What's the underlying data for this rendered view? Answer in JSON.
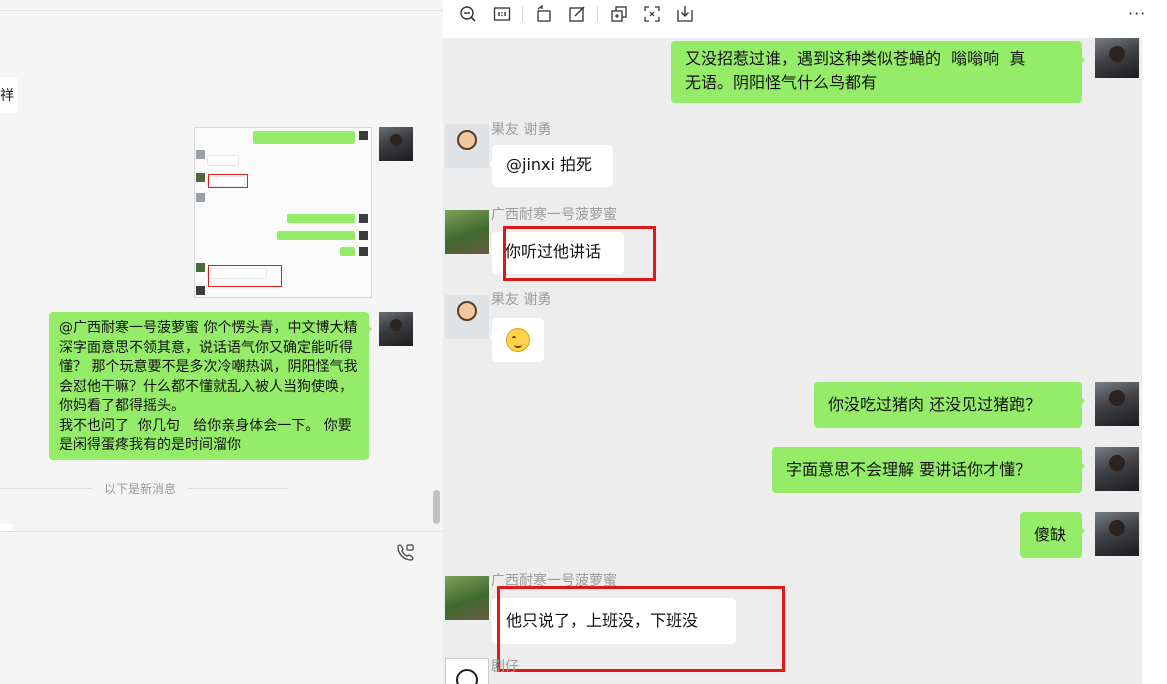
{
  "left_panel": {
    "cut_text": "祥",
    "long_message": "@广西耐寒一号菠萝蜜 你个愣头青，中文博大精深字面意思不领其意，说话语气你又确定能听得懂？ 那个玩意要不是多次冷嘲热讽，阴阳怪气我会怼他干嘛？什么都不懂就乱入被人当狗使唤，你妈看了都得摇头。\n我不也问了  你几句   给你亲身体会一下。 你要是闲得蛋疼我有的是时间溜你",
    "divider_text": "以下是新消息"
  },
  "toolbar": {
    "icons": [
      "zoom-out-icon",
      "actual-size-icon",
      "rotate-icon",
      "edit-icon",
      "copy-icon",
      "screenshot-icon",
      "download-icon",
      "more-icon"
    ],
    "more_label": "···"
  },
  "viewer": {
    "messages": [
      {
        "side": "right",
        "text": "又没招惹过谁，遇到这种类似苍蝇的  嗡嗡响  真\n无语。阴阳怪气什么鸟都有"
      },
      {
        "side": "left",
        "sender": "果友 谢勇",
        "text": "@jinxi 拍死"
      },
      {
        "side": "left",
        "sender": "广西耐寒一号菠萝蜜",
        "text": "你听过他讲话",
        "highlighted": true
      },
      {
        "side": "left",
        "sender": "果友 谢勇",
        "emoji": "smile-emoji"
      },
      {
        "side": "right",
        "text": "你没吃过猪肉 还没见过猪跑？"
      },
      {
        "side": "right",
        "text": "字面意思不会理解  要讲话你才懂？"
      },
      {
        "side": "right",
        "text": "傻缺"
      },
      {
        "side": "left",
        "sender": "广西耐寒一号菠萝蜜",
        "text": "他只说了，上班没，下班没",
        "highlighted": true
      },
      {
        "side": "left",
        "sender": "剧仔"
      }
    ]
  },
  "colors": {
    "self_bubble": "#95ec69",
    "other_bubble": "#ffffff",
    "viewer_bg": "#ededed",
    "highlight_box": "#e01818"
  }
}
